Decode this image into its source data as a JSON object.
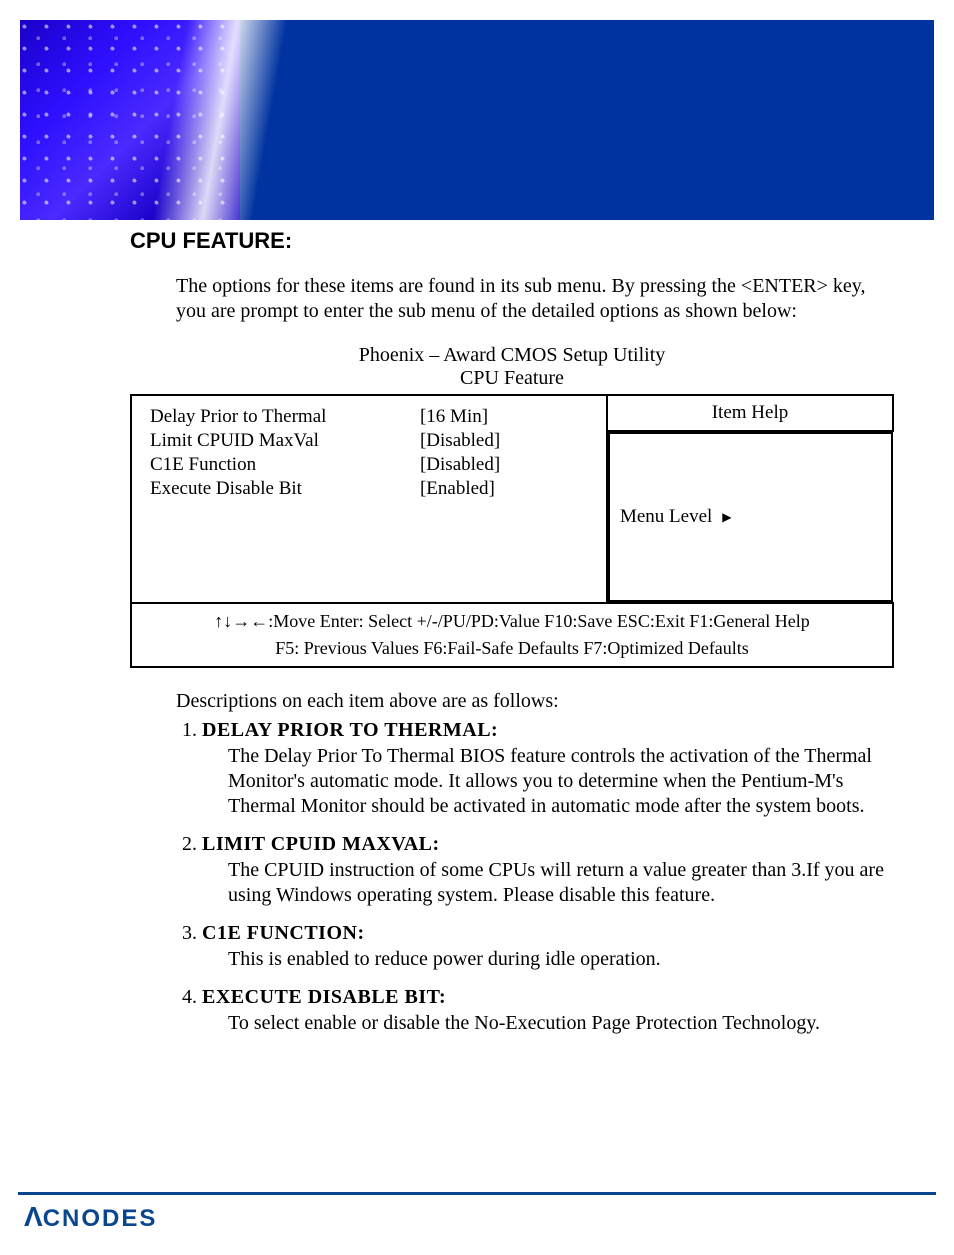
{
  "section_heading": "CPU FEATURE:",
  "intro": "The options for these items are found in its sub menu. By pressing the <ENTER> key, you are prompt to enter the sub menu of the detailed options as shown below:",
  "bios": {
    "title_line1": "Phoenix – Award CMOS Setup Utility",
    "title_line2": "CPU Feature",
    "items": [
      {
        "label": "Delay Prior to Thermal",
        "value": "[16 Min]"
      },
      {
        "label": "Limit CPUID MaxVal",
        "value": "[Disabled]"
      },
      {
        "label": "C1E Function",
        "value": "[Disabled]"
      },
      {
        "label": "Execute Disable Bit",
        "value": "[Enabled]"
      }
    ],
    "help_header": "Item Help",
    "menu_level_label": "Menu Level",
    "menu_level_arrow": "▶",
    "keys_line1": "↑↓→←:Move   Enter: Select   +/-/PU/PD:Value   F10:Save   ESC:Exit   F1:General Help",
    "keys_line2": "F5: Previous Values      F6:Fail-Safe Defaults      F7:Optimized Defaults"
  },
  "desc_intro": "Descriptions on each item above are as follows:",
  "descriptions": [
    {
      "head": "DELAY PRIOR TO THERMAL:",
      "body": "The Delay Prior To Thermal BIOS feature controls the activation of the Thermal Monitor's automatic mode. It allows you to determine when the Pentium-M's Thermal Monitor should be activated in automatic mode after the system boots."
    },
    {
      "head": "LIMIT CPUID MAXVAL:",
      "body": "The CPUID instruction of some CPUs will return a value greater than 3.If you are using Windows operating system. Please disable this feature."
    },
    {
      "head": "C1E FUNCTION:",
      "body": "This is enabled to reduce power during idle operation."
    },
    {
      "head": "EXECUTE DISABLE BIT:",
      "body": "To select enable or disable the No-Execution Page Protection Technology."
    }
  ],
  "brand": {
    "lambda": "Λ",
    "rest": "CNODES"
  }
}
